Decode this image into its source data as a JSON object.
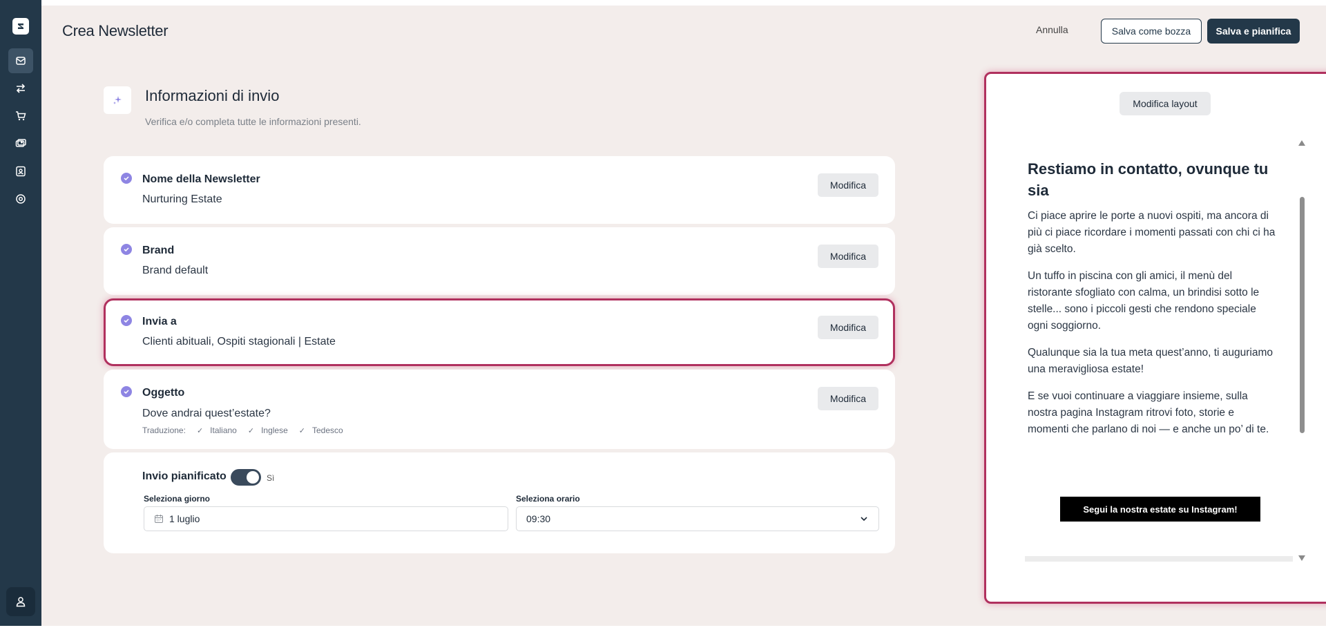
{
  "header": {
    "title": "Crea Newsletter",
    "cancel_label": "Annulla",
    "draft_label": "Salva come bozza",
    "schedule_label": "Salva e pianifica"
  },
  "sidebar": {
    "items": [
      {
        "icon": "mail-icon",
        "active": true
      },
      {
        "icon": "arrows-exchange-icon",
        "active": false
      },
      {
        "icon": "cart-icon",
        "active": false
      },
      {
        "icon": "cards-icon",
        "active": false
      },
      {
        "icon": "contact-icon",
        "active": false
      },
      {
        "icon": "settings-icon",
        "active": false
      }
    ],
    "user_icon": "user-icon"
  },
  "section": {
    "title": "Informazioni di invio",
    "subtitle": "Verifica e/o completa tutte le informazioni presenti."
  },
  "cards": {
    "name": {
      "label": "Nome della Newsletter",
      "value": "Nurturing Estate",
      "button": "Modifica"
    },
    "brand": {
      "label": "Brand",
      "value": "Brand default",
      "button": "Modifica"
    },
    "recipients": {
      "label": "Invia a",
      "value": "Clienti abituali, Ospiti stagionali | Estate",
      "button": "Modifica"
    },
    "subject": {
      "label": "Oggetto",
      "value": "Dove andrai quest’estate?",
      "button": "Modifica",
      "translation_label": "Traduzione:",
      "languages": [
        "Italiano",
        "Inglese",
        "Tedesco"
      ]
    }
  },
  "schedule": {
    "label": "Invio pianificato",
    "toggle_on": true,
    "toggle_state": "Sì",
    "day_label": "Seleziona giorno",
    "day_value": "1 luglio",
    "time_label": "Seleziona orario",
    "time_value": "09:30"
  },
  "preview": {
    "layout_button": "Modifica layout",
    "title": "Restiamo in contatto, ovunque tu sia",
    "paragraphs": [
      "Ci piace aprire le porte a nuovi ospiti, ma ancora di più ci piace ricordare i momenti passati con chi ci ha già scelto.",
      "Un tuffo in piscina con gli amici, il menù del ristorante sfogliato con calma, un brindisi sotto le stelle... sono i piccoli gesti che rendono speciale ogni soggiorno.",
      "Qualunque sia la tua meta quest’anno, ti auguriamo una meravigliosa estate!",
      "E se vuoi continuare a viaggiare insieme, sulla nostra pagina Instagram ritrovi foto, storie e momenti che parlano di noi — e anche un po’ di te."
    ],
    "cta": "Segui la nostra estate su Instagram!"
  },
  "colors": {
    "sidebar": "#233849",
    "background": "#f3edeb",
    "accent_highlight": "#b0305e",
    "check": "#8e85e3"
  }
}
